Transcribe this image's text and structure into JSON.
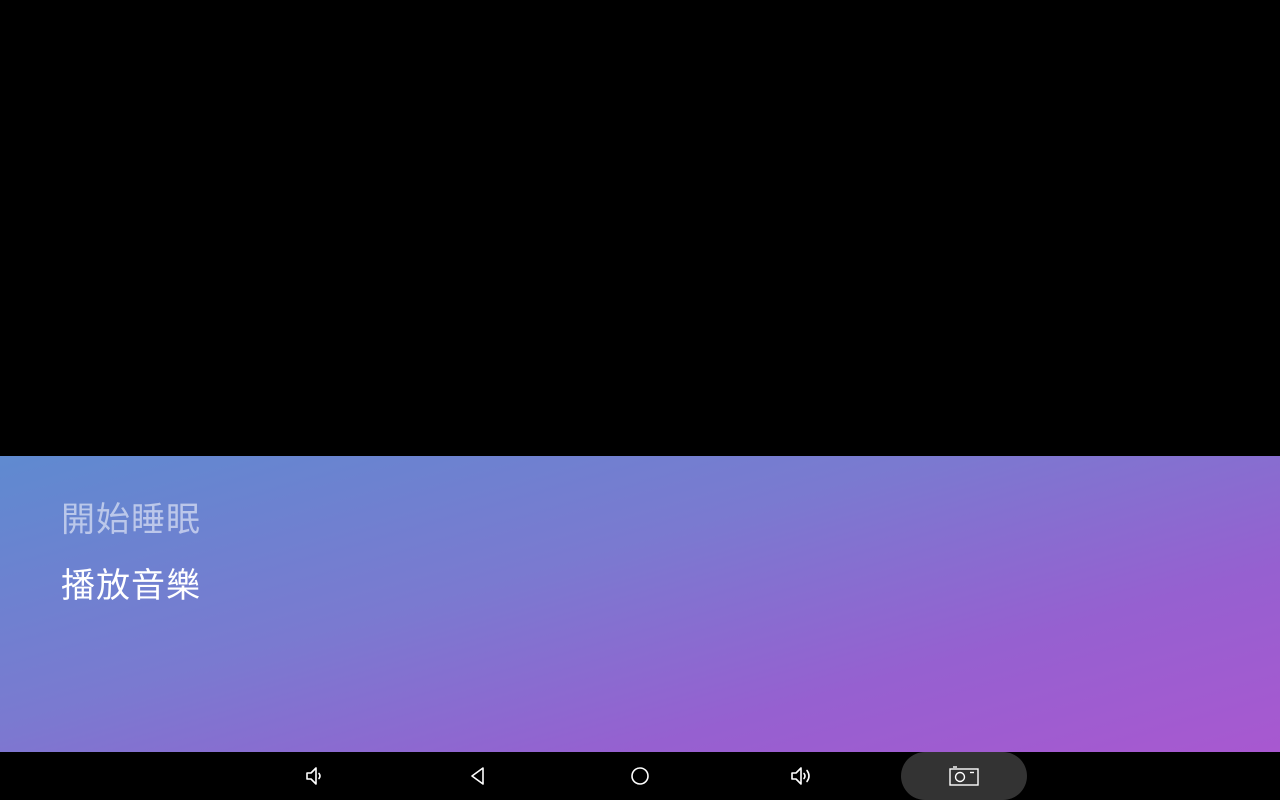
{
  "menu": {
    "items": [
      {
        "label": "開始睡眠",
        "state": "dimmed"
      },
      {
        "label": "播放音樂",
        "state": "normal"
      }
    ]
  },
  "colors": {
    "sheet_gradient_start": "#5f8ad0",
    "sheet_gradient_end": "#a858d0",
    "nav_bar": "#000000",
    "screenshot_button_bg": "#333333"
  },
  "nav_bar": {
    "buttons": [
      {
        "icon": "volume-down-icon"
      },
      {
        "icon": "back-icon"
      },
      {
        "icon": "home-icon"
      },
      {
        "icon": "volume-up-icon"
      },
      {
        "icon": "screenshot-icon"
      }
    ]
  }
}
